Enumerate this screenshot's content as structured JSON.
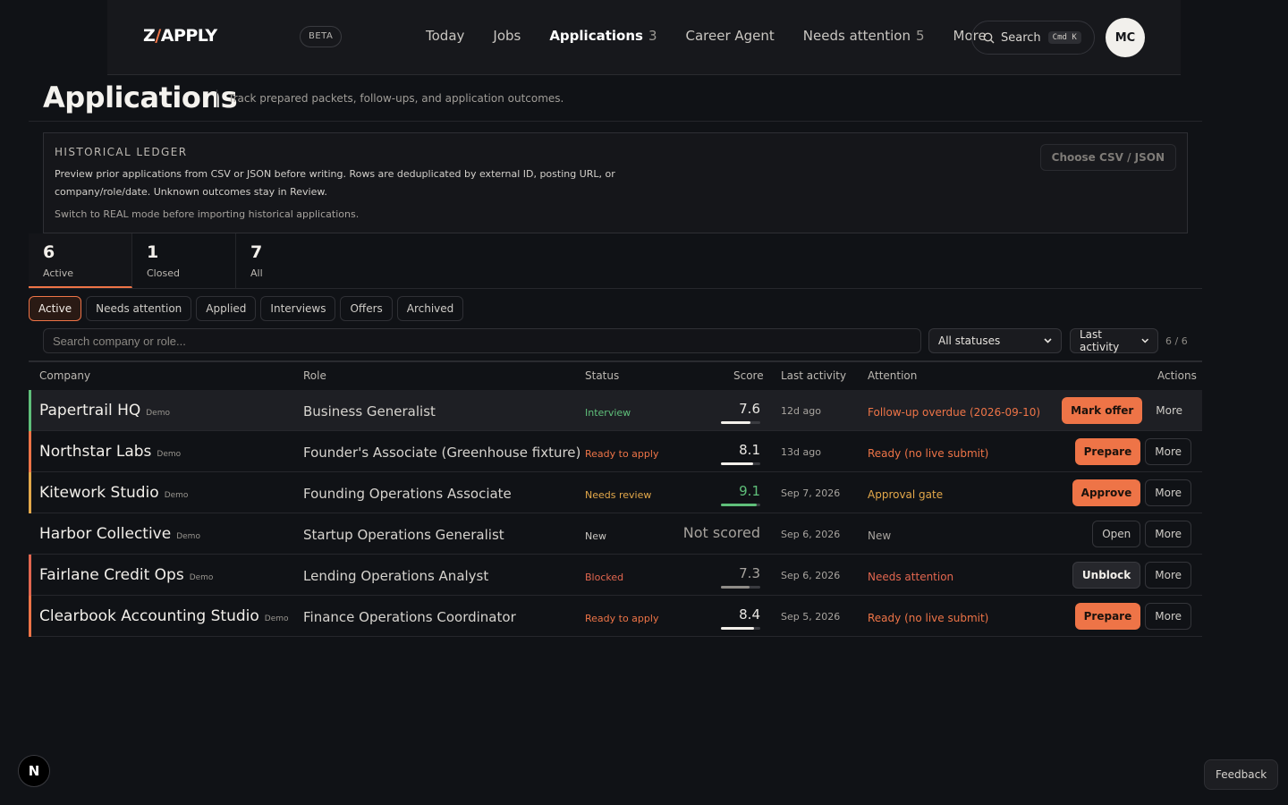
{
  "colors": {
    "accent": "#ee7447",
    "interview": "#5fbf7a",
    "ready": "#ee7447",
    "review": "#e3a84a",
    "blocked": "#e2664f",
    "new": "#c9c6c1"
  },
  "header": {
    "logo_prefix": "Z",
    "logo_slash": "/",
    "logo_suffix": "APPLY",
    "beta": "BETA",
    "nav": [
      {
        "label": "Today",
        "count": ""
      },
      {
        "label": "Jobs",
        "count": ""
      },
      {
        "label": "Applications",
        "count": "3"
      },
      {
        "label": "Career Agent",
        "count": ""
      },
      {
        "label": "Needs attention",
        "count": "5"
      },
      {
        "label": "More",
        "count": ""
      }
    ],
    "search_label": "Search",
    "search_shortcut": "Cmd K",
    "avatar_initials": "MC"
  },
  "page": {
    "title": "Applications",
    "subtitle": "Track prepared packets, follow-ups, and application outcomes."
  },
  "ledger": {
    "heading": "HISTORICAL LEDGER",
    "description": "Preview prior applications from CSV or JSON before writing. Rows are deduplicated by external ID, posting URL, or company/role/date. Unknown outcomes stay in Review.",
    "note": "Switch to REAL mode before importing historical applications.",
    "button": "Choose CSV / JSON"
  },
  "summary": [
    {
      "count": "6",
      "label": "Active"
    },
    {
      "count": "1",
      "label": "Closed"
    },
    {
      "count": "7",
      "label": "All"
    }
  ],
  "chips": [
    "Active",
    "Needs attention",
    "Applied",
    "Interviews",
    "Offers",
    "Archived"
  ],
  "filters": {
    "search_placeholder": "Search company or role...",
    "status_select": "All statuses",
    "sort_select": "Last activity",
    "result_count": "6 / 6"
  },
  "table": {
    "headers": {
      "company": "Company",
      "role": "Role",
      "status": "Status",
      "score": "Score",
      "last_activity": "Last activity",
      "attention": "Attention",
      "actions": "Actions"
    },
    "rows": [
      {
        "company": "Papertrail HQ",
        "tag": "Demo",
        "role": "Business Generalist",
        "status": "Interview",
        "score": "7.6",
        "score_value": 0.76,
        "last_activity": "12d ago",
        "attention": "Follow-up overdue (2026-09-10)",
        "primary_action": "Mark offer",
        "secondary_action": "More"
      },
      {
        "company": "Northstar Labs",
        "tag": "Demo",
        "role": "Founder's Associate (Greenhouse fixture)",
        "status": "Ready to apply",
        "score": "8.1",
        "score_value": 0.81,
        "last_activity": "13d ago",
        "attention": "Ready (no live submit)",
        "primary_action": "Prepare",
        "secondary_action": "More"
      },
      {
        "company": "Kitework Studio",
        "tag": "Demo",
        "role": "Founding Operations Associate",
        "status": "Needs review",
        "score": "9.1",
        "score_value": 0.91,
        "last_activity": "Sep 7, 2026",
        "attention": "Approval gate",
        "primary_action": "Approve",
        "secondary_action": "More"
      },
      {
        "company": "Harbor Collective",
        "tag": "Demo",
        "role": "Startup Operations Generalist",
        "status": "New",
        "score": "Not scored",
        "score_value": null,
        "last_activity": "Sep 6, 2026",
        "attention": "New",
        "primary_action": "Open",
        "secondary_action": "More"
      },
      {
        "company": "Fairlane Credit Ops",
        "tag": "Demo",
        "role": "Lending Operations Analyst",
        "status": "Blocked",
        "score": "7.3",
        "score_value": 0.73,
        "last_activity": "Sep 6, 2026",
        "attention": "Needs attention",
        "primary_action": "Unblock",
        "secondary_action": "More"
      },
      {
        "company": "Clearbook Accounting Studio",
        "tag": "Demo",
        "role": "Finance Operations Coordinator",
        "status": "Ready to apply",
        "score": "8.4",
        "score_value": 0.84,
        "last_activity": "Sep 5, 2026",
        "attention": "Ready (no live submit)",
        "primary_action": "Prepare",
        "secondary_action": "More"
      }
    ]
  },
  "footer": {
    "dev_badge": "N",
    "feedback": "Feedback"
  }
}
